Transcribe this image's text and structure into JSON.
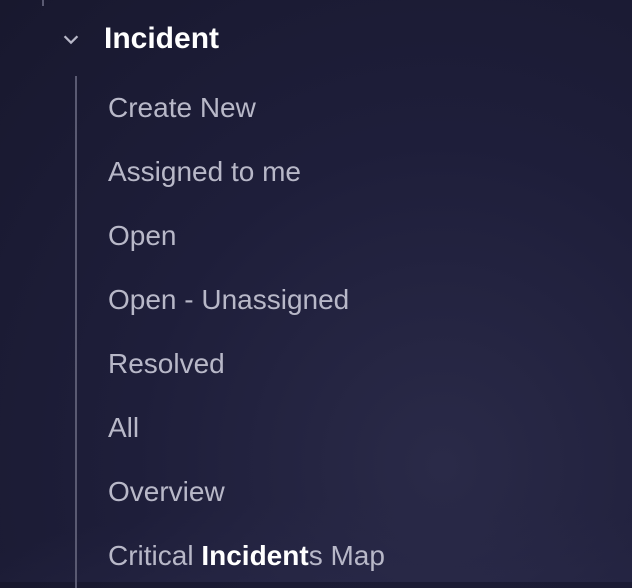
{
  "sidebar": {
    "section": {
      "title": "Incident",
      "expanded": true,
      "items": [
        {
          "label": "Create New"
        },
        {
          "label": "Assigned to me"
        },
        {
          "label": "Open"
        },
        {
          "label": "Open - Unassigned"
        },
        {
          "label": "Resolved"
        },
        {
          "label": "All"
        },
        {
          "label": "Overview"
        },
        {
          "label_pre": "Critical ",
          "label_hl": "Incident",
          "label_post": "s Map"
        }
      ]
    }
  }
}
